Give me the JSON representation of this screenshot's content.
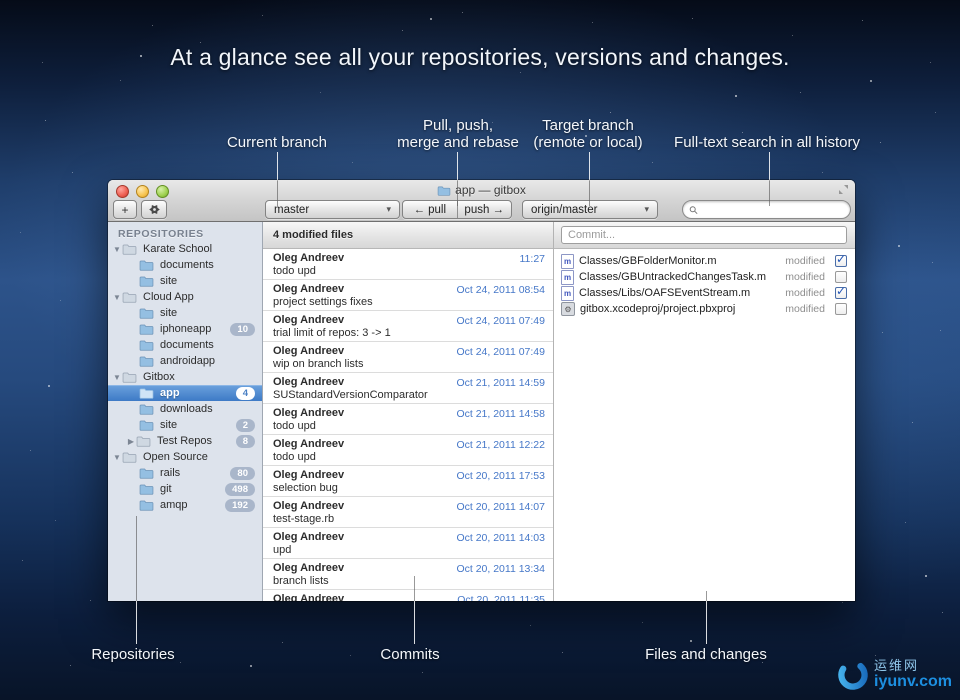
{
  "hero_title": "At a glance see all your repositories, versions and changes.",
  "callouts_top": {
    "current_branch": "Current branch",
    "pull_push_line1": "Pull, push,",
    "pull_push_line2": "merge and rebase",
    "target_branch_line1": "Target branch",
    "target_branch_line2": "(remote or local)",
    "search": "Full-text search in all history"
  },
  "callouts_bottom": {
    "repositories": "Repositories",
    "commits": "Commits",
    "files": "Files and changes"
  },
  "window": {
    "title": "app — gitbox",
    "toolbar": {
      "add_label": "+",
      "current_branch": "master",
      "pull_label": "← pull",
      "push_label": "push →",
      "target_branch": "origin/master",
      "search_value": ""
    }
  },
  "icons": {
    "dropdown_arrow": "▾",
    "disclosure_open": "▼",
    "disclosure_closed": "▶",
    "check_glyph": "✓",
    "objc_letter": "m",
    "project_glyph": "⚙"
  },
  "sidebar": {
    "header": "REPOSITORIES",
    "items": [
      {
        "label": "Karate School",
        "kind": "group",
        "disclosure": "open"
      },
      {
        "label": "documents",
        "kind": "repo"
      },
      {
        "label": "site",
        "kind": "repo"
      },
      {
        "label": "Cloud App",
        "kind": "group",
        "disclosure": "open"
      },
      {
        "label": "site",
        "kind": "repo"
      },
      {
        "label": "iphoneapp",
        "kind": "repo",
        "badge": "10"
      },
      {
        "label": "documents",
        "kind": "repo"
      },
      {
        "label": "androidapp",
        "kind": "repo"
      },
      {
        "label": "Gitbox",
        "kind": "group",
        "disclosure": "open"
      },
      {
        "label": "app",
        "kind": "repo",
        "badge": "4",
        "selected": true
      },
      {
        "label": "downloads",
        "kind": "repo"
      },
      {
        "label": "site",
        "kind": "repo",
        "badge": "2"
      },
      {
        "label": "Test Repos",
        "kind": "group-nested",
        "disclosure": "closed",
        "badge": "8"
      },
      {
        "label": "Open Source",
        "kind": "group",
        "disclosure": "open"
      },
      {
        "label": "rails",
        "kind": "repo",
        "badge": "80"
      },
      {
        "label": "git",
        "kind": "repo",
        "badge": "498"
      },
      {
        "label": "amqp",
        "kind": "repo",
        "badge": "192"
      }
    ]
  },
  "commits": {
    "header": "4 modified files",
    "rows": [
      {
        "author": "Oleg Andreev",
        "message": "todo upd",
        "date": "11:27"
      },
      {
        "author": "Oleg Andreev",
        "message": "project settings fixes",
        "date": "Oct 24, 2011 08:54"
      },
      {
        "author": "Oleg Andreev",
        "message": "trial limit of repos: 3 -> 1",
        "date": "Oct 24, 2011 07:49"
      },
      {
        "author": "Oleg Andreev",
        "message": "wip on branch lists",
        "date": "Oct 24, 2011 07:49"
      },
      {
        "author": "Oleg Andreev",
        "message": "SUStandardVersionComparator",
        "date": "Oct 21, 2011 14:59"
      },
      {
        "author": "Oleg Andreev",
        "message": "todo upd",
        "date": "Oct 21, 2011 14:58"
      },
      {
        "author": "Oleg Andreev",
        "message": "todo upd",
        "date": "Oct 21, 2011 12:22"
      },
      {
        "author": "Oleg Andreev",
        "message": "selection bug",
        "date": "Oct 20, 2011 17:53"
      },
      {
        "author": "Oleg Andreev",
        "message": "test-stage.rb",
        "date": "Oct 20, 2011 14:07"
      },
      {
        "author": "Oleg Andreev",
        "message": "upd",
        "date": "Oct 20, 2011 14:03"
      },
      {
        "author": "Oleg Andreev",
        "message": "branch lists",
        "date": "Oct 20, 2011 13:34"
      },
      {
        "author": "Oleg Andreev",
        "message": "",
        "date": "Oct 20, 2011 11:35"
      }
    ]
  },
  "stage": {
    "commit_placeholder": "Commit...",
    "files": [
      {
        "name": "Classes/GBFolderMonitor.m",
        "status": "modified",
        "checked": true,
        "icon": "objc-file-icon"
      },
      {
        "name": "Classes/GBUntrackedChangesTask.m",
        "status": "modified",
        "checked": false,
        "icon": "objc-file-icon"
      },
      {
        "name": "Classes/Libs/OAFSEventStream.m",
        "status": "modified",
        "checked": true,
        "icon": "objc-file-icon"
      },
      {
        "name": "gitbox.xcodeproj/project.pbxproj",
        "status": "modified",
        "checked": false,
        "icon": "project-file-icon"
      }
    ]
  },
  "watermark": {
    "site_name": "运维网",
    "site_url": "iyunv.com"
  },
  "colors": {
    "selection_blue": "#3d7ac6",
    "date_blue": "#4577c8",
    "badge_gray": "#a9b6ca",
    "sidebar_bg": "#dde3ec",
    "sky_mid": "#2d538a"
  }
}
